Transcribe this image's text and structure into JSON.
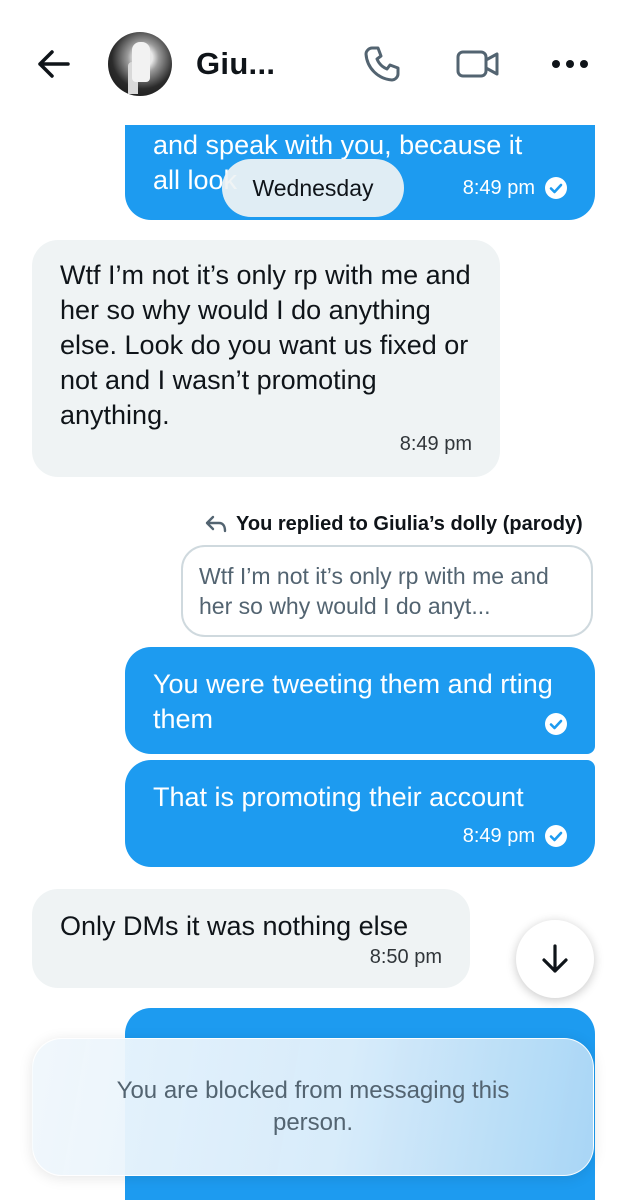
{
  "header": {
    "contact_name": "Giu...",
    "back_icon": "arrow-left-icon",
    "phone_icon": "phone-icon",
    "video_icon": "video-camera-icon",
    "more_icon": "more-horizontal-icon"
  },
  "day_separator": "Wednesday",
  "messages": [
    {
      "direction": "sent",
      "text": "and speak with you, because it\nall look",
      "time": "8:49 pm",
      "read": true
    },
    {
      "direction": "received",
      "text": "Wtf I’m not it’s only rp with me and her so why would I do anything else. Look do you want us fixed or not and I wasn’t promoting anything.",
      "time": "8:49 pm"
    },
    {
      "direction": "sent",
      "text": "You were tweeting them and rting them",
      "time": "",
      "read": true
    },
    {
      "direction": "sent",
      "text": "That is promoting their account",
      "time": "8:49 pm",
      "read": true
    },
    {
      "direction": "received",
      "text": "Only DMs it was nothing else",
      "time": "8:50 pm"
    },
    {
      "direction": "sent",
      "text": "",
      "time": "",
      "read": false
    }
  ],
  "reply_context": {
    "label": "You replied to Giulia’s dolly (parody)",
    "quoted_text": "Wtf I’m not it’s only rp with me and her so why would I do anyt..."
  },
  "scroll_button": {
    "icon": "arrow-down-icon"
  },
  "blocked_notice": "You are blocked from messaging this person.",
  "colors": {
    "accent": "#1d9bf0",
    "received_bubble": "#eff3f4",
    "text": "#0f1419",
    "muted": "#536471"
  }
}
